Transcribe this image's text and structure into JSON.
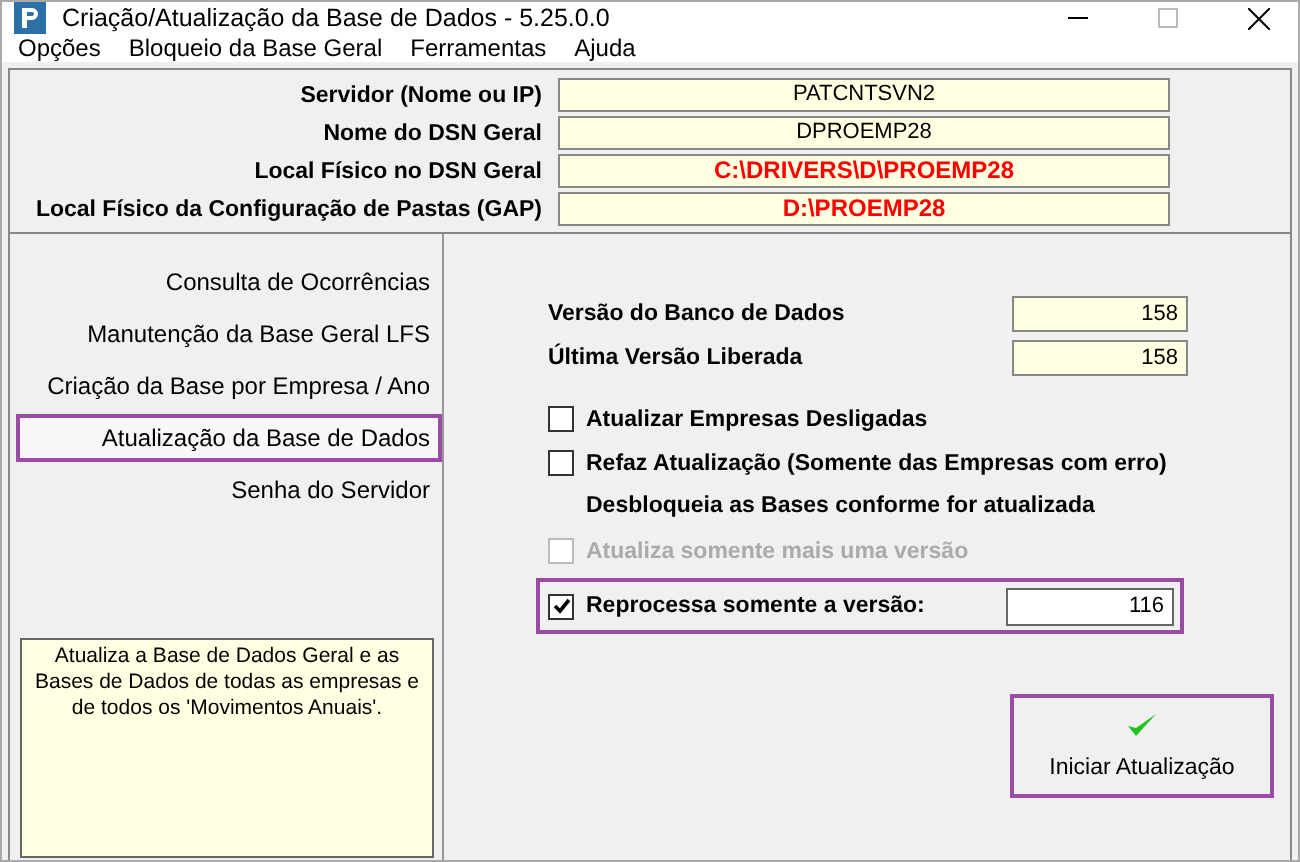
{
  "window": {
    "title": "Criação/Atualização da Base de Dados - 5.25.0.0"
  },
  "menu": [
    "Opções",
    "Bloqueio da Base Geral",
    "Ferramentas",
    "Ajuda"
  ],
  "connection": [
    {
      "label": "Servidor (Nome ou IP)",
      "value": "PATCNTSVN2",
      "alert": false
    },
    {
      "label": "Nome do DSN Geral",
      "value": "DPROEMP28",
      "alert": false
    },
    {
      "label": "Local Físico no DSN Geral",
      "value": "C:\\DRIVERS\\D\\PROEMP28",
      "alert": true
    },
    {
      "label": "Local Físico da Configuração de Pastas (GAP)",
      "value": "D:\\PROEMP28",
      "alert": true
    }
  ],
  "sidebar": {
    "items": [
      {
        "label": "Consulta de Ocorrências",
        "selected": false
      },
      {
        "label": "Manutenção da Base Geral LFS",
        "selected": false
      },
      {
        "label": "Criação da Base por Empresa / Ano",
        "selected": false
      },
      {
        "label": "Atualização da Base de Dados",
        "selected": true
      },
      {
        "label": "Senha do Servidor",
        "selected": false
      }
    ],
    "description": "Atualiza a Base de Dados Geral e as Bases de Dados de todas as empresas e de todos os 'Movimentos Anuais'."
  },
  "versions": [
    {
      "label": "Versão do Banco de Dados",
      "value": "158"
    },
    {
      "label": "Última Versão Liberada",
      "value": "158"
    }
  ],
  "options": [
    {
      "kind": "checkbox",
      "label": "Atualizar Empresas Desligadas",
      "checked": false,
      "disabled": false,
      "highlighted": false
    },
    {
      "kind": "checkbox",
      "label": "Refaz Atualização (Somente das Empresas com erro)",
      "checked": false,
      "disabled": false,
      "highlighted": false
    },
    {
      "kind": "note",
      "label": "Desbloqueia as Bases conforme for atualizada"
    },
    {
      "kind": "checkbox",
      "label": "Atualiza somente mais uma versão",
      "checked": false,
      "disabled": true,
      "highlighted": false
    },
    {
      "kind": "checkbox_input",
      "label": "Reprocessa somente a versão:",
      "checked": true,
      "disabled": false,
      "highlighted": true,
      "value": "116"
    }
  ],
  "start_button": {
    "label": "Iniciar Atualização",
    "highlighted": true
  }
}
